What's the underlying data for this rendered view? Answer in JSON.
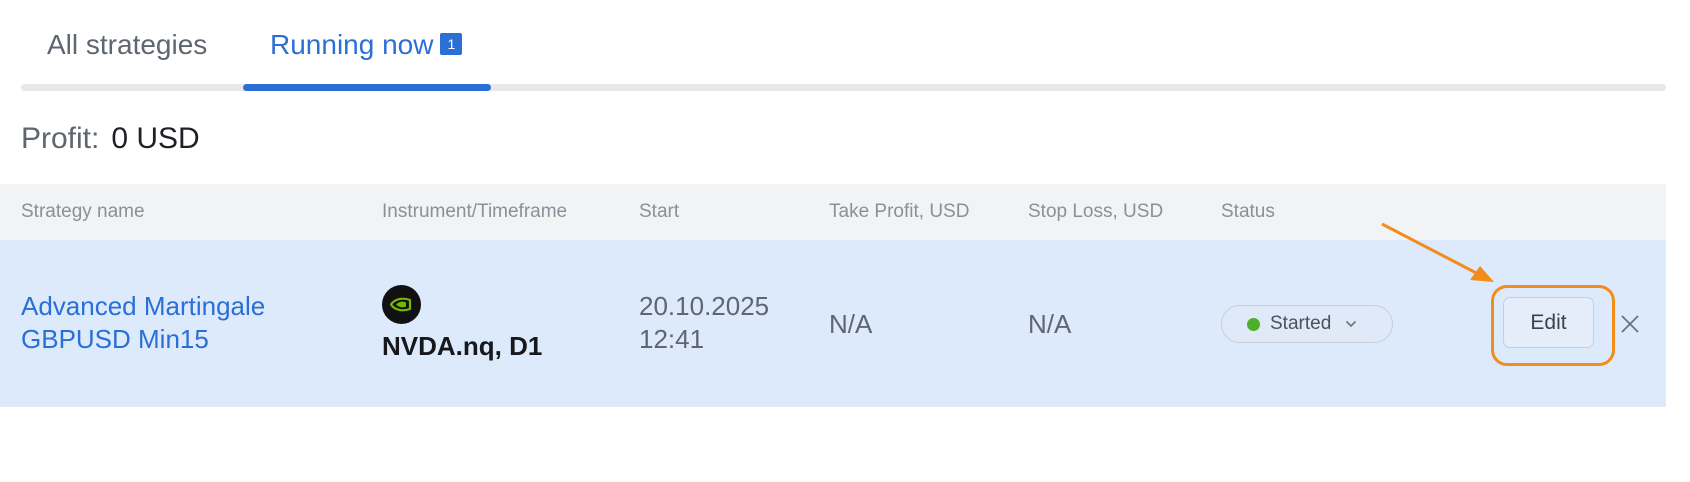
{
  "tabs": [
    {
      "label": "All strategies"
    },
    {
      "label": "Running now",
      "badge": "1"
    }
  ],
  "profit": {
    "label": "Profit:",
    "value": "0 USD"
  },
  "table": {
    "headers": [
      "Strategy name",
      "Instrument/Timeframe",
      "Start",
      "Take Profit, USD",
      "Stop Loss, USD",
      "Status"
    ],
    "rows": [
      {
        "strategy_line1": "Advanced Martingale",
        "strategy_line2": "GBPUSD Min15",
        "instrument_icon": "nvidia-logo-icon",
        "instrument": "NVDA.nq, D1",
        "start_date": "20.10.2025",
        "start_time": "12:41",
        "take_profit": "N/A",
        "stop_loss": "N/A",
        "status": "Started",
        "edit_label": "Edit"
      }
    ]
  },
  "colors": {
    "accent": "#2a6fd6",
    "row_highlight": "#ddeafb",
    "annotation": "#f28c1a",
    "status_started": "#4caf2b"
  },
  "icons": {
    "status_dropdown": "chevron-down-icon",
    "remove": "close-icon",
    "annotation": "arrow-icon"
  }
}
